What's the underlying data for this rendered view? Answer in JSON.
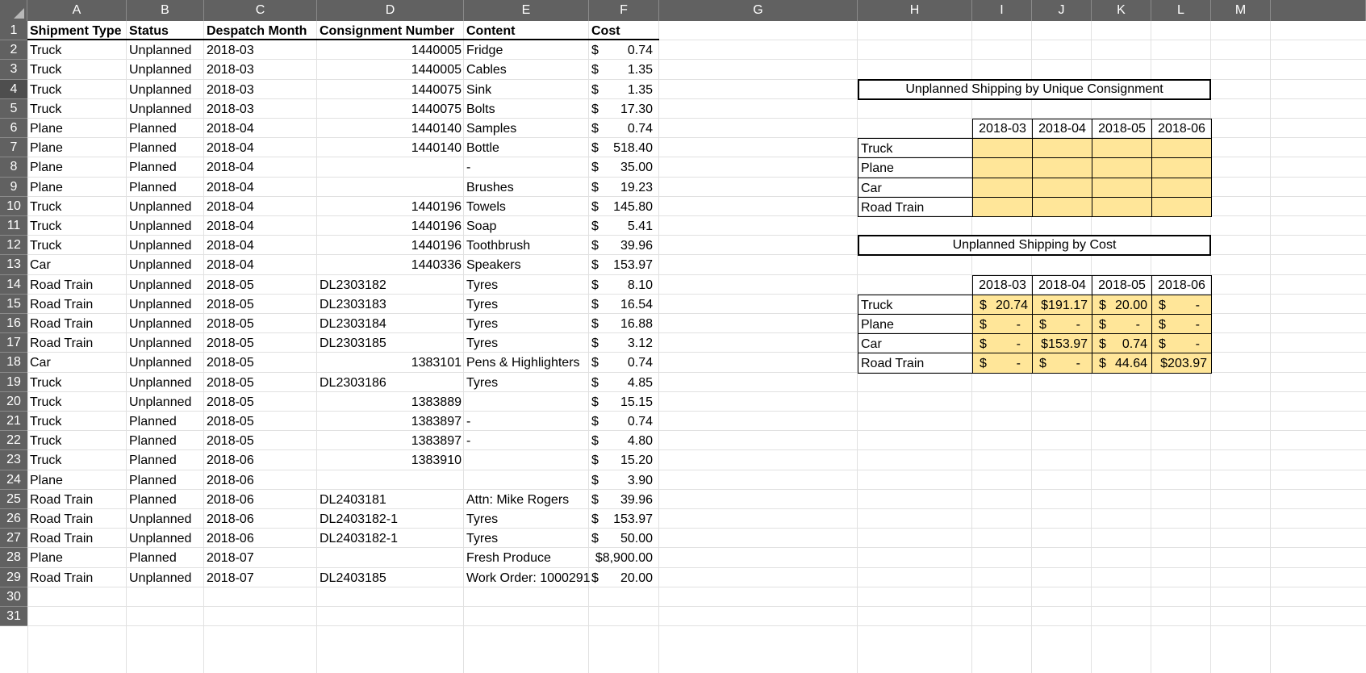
{
  "columns": [
    "A",
    "B",
    "C",
    "D",
    "E",
    "F",
    "G",
    "H",
    "I",
    "J",
    "K",
    "L",
    "M"
  ],
  "row_numbers": [
    "1",
    "2",
    "3",
    "4",
    "5",
    "6",
    "7",
    "8",
    "9",
    "10",
    "11",
    "12",
    "13",
    "14",
    "15",
    "16",
    "17",
    "18",
    "19",
    "20",
    "21",
    "22",
    "23",
    "24",
    "25",
    "26",
    "27",
    "28",
    "29",
    "30",
    "31"
  ],
  "headers": {
    "shipment_type": "Shipment Type",
    "status": "Status",
    "despatch_month": "Despatch Month",
    "consignment_number": "Consignment Number",
    "content": "Content",
    "cost": "Cost"
  },
  "rows": [
    {
      "type": "Truck",
      "status": "Unplanned",
      "month": "2018-03",
      "consignment": "1440005",
      "content": "Fridge",
      "cost": "0.74"
    },
    {
      "type": "Truck",
      "status": "Unplanned",
      "month": "2018-03",
      "consignment": "1440005",
      "content": "Cables",
      "cost": "1.35"
    },
    {
      "type": "Truck",
      "status": "Unplanned",
      "month": "2018-03",
      "consignment": "1440075",
      "content": "Sink",
      "cost": "1.35"
    },
    {
      "type": "Truck",
      "status": "Unplanned",
      "month": "2018-03",
      "consignment": "1440075",
      "content": "Bolts",
      "cost": "17.30"
    },
    {
      "type": "Plane",
      "status": "Planned",
      "month": "2018-04",
      "consignment": "1440140",
      "content": "Samples",
      "cost": "0.74"
    },
    {
      "type": "Plane",
      "status": "Planned",
      "month": "2018-04",
      "consignment": "1440140",
      "content": "Bottle",
      "cost": "518.40"
    },
    {
      "type": "Plane",
      "status": "Planned",
      "month": "2018-04",
      "consignment": "",
      "content": "-",
      "cost": "35.00"
    },
    {
      "type": "Plane",
      "status": "Planned",
      "month": "2018-04",
      "consignment": "",
      "content": "Brushes",
      "cost": "19.23"
    },
    {
      "type": "Truck",
      "status": "Unplanned",
      "month": "2018-04",
      "consignment": "1440196",
      "content": "Towels",
      "cost": "145.80"
    },
    {
      "type": "Truck",
      "status": "Unplanned",
      "month": "2018-04",
      "consignment": "1440196",
      "content": "Soap",
      "cost": "5.41"
    },
    {
      "type": "Truck",
      "status": "Unplanned",
      "month": "2018-04",
      "consignment": "1440196",
      "content": "Toothbrush",
      "cost": "39.96"
    },
    {
      "type": "Car",
      "status": "Unplanned",
      "month": "2018-04",
      "consignment": "1440336",
      "content": "Speakers",
      "cost": "153.97"
    },
    {
      "type": "Road Train",
      "status": "Unplanned",
      "month": "2018-05",
      "consignment": "DL2303182",
      "content": "Tyres",
      "cost": "8.10"
    },
    {
      "type": "Road Train",
      "status": "Unplanned",
      "month": "2018-05",
      "consignment": "DL2303183",
      "content": "Tyres",
      "cost": "16.54"
    },
    {
      "type": "Road Train",
      "status": "Unplanned",
      "month": "2018-05",
      "consignment": "DL2303184",
      "content": "Tyres",
      "cost": "16.88"
    },
    {
      "type": "Road Train",
      "status": "Unplanned",
      "month": "2018-05",
      "consignment": "DL2303185",
      "content": "Tyres",
      "cost": "3.12"
    },
    {
      "type": "Car",
      "status": "Unplanned",
      "month": "2018-05",
      "consignment": "1383101",
      "content": "Pens & Highlighters",
      "cost": "0.74"
    },
    {
      "type": "Truck",
      "status": "Unplanned",
      "month": "2018-05",
      "consignment": "DL2303186",
      "content": "Tyres",
      "cost": "4.85"
    },
    {
      "type": "Truck",
      "status": "Unplanned",
      "month": "2018-05",
      "consignment": "1383889",
      "content": "",
      "cost": "15.15"
    },
    {
      "type": "Truck",
      "status": "Planned",
      "month": "2018-05",
      "consignment": "1383897",
      "content": "-",
      "cost": "0.74"
    },
    {
      "type": "Truck",
      "status": "Planned",
      "month": "2018-05",
      "consignment": "1383897",
      "content": "-",
      "cost": "4.80"
    },
    {
      "type": "Truck",
      "status": "Planned",
      "month": "2018-06",
      "consignment": "1383910",
      "content": "",
      "cost": "15.20"
    },
    {
      "type": "Plane",
      "status": "Planned",
      "month": "2018-06",
      "consignment": "",
      "content": "",
      "cost": "3.90"
    },
    {
      "type": "Road Train",
      "status": "Planned",
      "month": "2018-06",
      "consignment": "DL2403181",
      "content": "Attn: Mike Rogers",
      "cost": "39.96"
    },
    {
      "type": "Road Train",
      "status": "Unplanned",
      "month": "2018-06",
      "consignment": "DL2403182-1",
      "content": "Tyres",
      "cost": "153.97"
    },
    {
      "type": "Road Train",
      "status": "Unplanned",
      "month": "2018-06",
      "consignment": "DL2403182-1",
      "content": "Tyres",
      "cost": "50.00"
    },
    {
      "type": "Plane",
      "status": "Planned",
      "month": "2018-07",
      "consignment": "",
      "content": "Fresh Produce",
      "cost": "$8,900.00"
    },
    {
      "type": "Road Train",
      "status": "Unplanned",
      "month": "2018-07",
      "consignment": "DL2403185",
      "content": "Work Order: 1000291",
      "cost": "20.00"
    }
  ],
  "currency_symbol": "$",
  "summary1": {
    "title": "Unplanned Shipping by Unique Consignment",
    "months": [
      "2018-03",
      "2018-04",
      "2018-05",
      "2018-06"
    ],
    "row_labels": [
      "Truck",
      "Plane",
      "Car",
      "Road Train"
    ]
  },
  "summary2": {
    "title": "Unplanned Shipping by Cost",
    "months": [
      "2018-03",
      "2018-04",
      "2018-05",
      "2018-06"
    ],
    "rows": [
      {
        "label": "Truck",
        "cells": [
          {
            "sym": "$",
            "val": "20.74"
          },
          {
            "sym": "",
            "val": "$191.17"
          },
          {
            "sym": "$",
            "val": "20.00"
          },
          {
            "sym": "$",
            "val": "-"
          }
        ]
      },
      {
        "label": "Plane",
        "cells": [
          {
            "sym": "$",
            "val": "-"
          },
          {
            "sym": "$",
            "val": "-"
          },
          {
            "sym": "$",
            "val": "-"
          },
          {
            "sym": "$",
            "val": "-"
          }
        ]
      },
      {
        "label": "Car",
        "cells": [
          {
            "sym": "$",
            "val": "-"
          },
          {
            "sym": "",
            "val": "$153.97"
          },
          {
            "sym": "$",
            "val": "0.74"
          },
          {
            "sym": "$",
            "val": "-"
          }
        ]
      },
      {
        "label": "Road Train",
        "cells": [
          {
            "sym": "$",
            "val": "-"
          },
          {
            "sym": "$",
            "val": "-"
          },
          {
            "sym": "$",
            "val": "44.64"
          },
          {
            "sym": "",
            "val": "$203.97"
          }
        ]
      }
    ]
  },
  "colors": {
    "header_bg": "#616161",
    "gridline": "#e1e1e1",
    "highlight_fill": "#ffe699"
  }
}
